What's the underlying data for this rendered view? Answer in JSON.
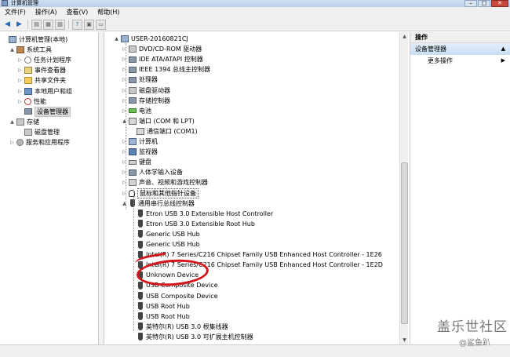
{
  "window": {
    "title": "计算机管理"
  },
  "menu": [
    "文件(F)",
    "操作(A)",
    "查看(V)",
    "帮助(H)"
  ],
  "left_tree": [
    {
      "label": "计算机管理(本地)",
      "icon": "computer-icon",
      "level": 0,
      "exp": ""
    },
    {
      "label": "系统工具",
      "icon": "tools-icon",
      "level": 1,
      "exp": "▲"
    },
    {
      "label": "任务计划程序",
      "icon": "clock-icon",
      "level": 2,
      "exp": "▷"
    },
    {
      "label": "事件查看器",
      "icon": "event-log-icon",
      "level": 2,
      "exp": "▷"
    },
    {
      "label": "共享文件夹",
      "icon": "folder-icon",
      "level": 2,
      "exp": "▷"
    },
    {
      "label": "本地用户和组",
      "icon": "users-icon",
      "level": 2,
      "exp": "▷"
    },
    {
      "label": "性能",
      "icon": "performance-icon",
      "level": 2,
      "exp": "▷"
    },
    {
      "label": "设备管理器",
      "icon": "device-manager-icon",
      "level": 2,
      "exp": "",
      "selected": true
    },
    {
      "label": "存储",
      "icon": "storage-icon",
      "level": 1,
      "exp": "▲"
    },
    {
      "label": "磁盘管理",
      "icon": "disk-icon",
      "level": 2,
      "exp": ""
    },
    {
      "label": "服务和应用程序",
      "icon": "services-icon",
      "level": 1,
      "exp": "▷"
    }
  ],
  "device_tree": [
    {
      "label": "USER-20160821CJ",
      "icon": "computer-icon",
      "level": 0,
      "exp": "▲"
    },
    {
      "label": "DVD/CD-ROM 驱动器",
      "icon": "dvd-drive-icon",
      "level": 1,
      "exp": "▷"
    },
    {
      "label": "IDE ATA/ATAPI 控制器",
      "icon": "ide-controller-icon",
      "level": 1,
      "exp": "▷"
    },
    {
      "label": "IEEE 1394 总线主控制器",
      "icon": "firewire-icon",
      "level": 1,
      "exp": "▷"
    },
    {
      "label": "处理器",
      "icon": "processor-icon",
      "level": 1,
      "exp": "▷"
    },
    {
      "label": "磁盘驱动器",
      "icon": "disk-drive-icon",
      "level": 1,
      "exp": "▷"
    },
    {
      "label": "存储控制器",
      "icon": "storage-controller-icon",
      "level": 1,
      "exp": "▷"
    },
    {
      "label": "电池",
      "icon": "battery-icon",
      "level": 1,
      "exp": "▷"
    },
    {
      "label": "端口 (COM 和 LPT)",
      "icon": "port-icon",
      "level": 1,
      "exp": "▲"
    },
    {
      "label": "通信端口 (COM1)",
      "icon": "port-icon",
      "level": 2,
      "exp": ""
    },
    {
      "label": "计算机",
      "icon": "computer-icon",
      "level": 1,
      "exp": "▷"
    },
    {
      "label": "监视器",
      "icon": "monitor-icon",
      "level": 1,
      "exp": "▷"
    },
    {
      "label": "键盘",
      "icon": "keyboard-icon",
      "level": 1,
      "exp": "▷"
    },
    {
      "label": "人体学输入设备",
      "icon": "hid-icon",
      "level": 1,
      "exp": "▷"
    },
    {
      "label": "声音、视频和游戏控制器",
      "icon": "sound-icon",
      "level": 1,
      "exp": "▷"
    },
    {
      "label": "鼠标和其他指针设备",
      "icon": "mouse-icon",
      "level": 1,
      "exp": "▷",
      "selected": true
    },
    {
      "label": "通用串行总线控制器",
      "icon": "usb-icon",
      "level": 1,
      "exp": "▲"
    },
    {
      "label": "Etron USB 3.0 Extensible Host Controller",
      "icon": "usb-icon",
      "level": 2,
      "exp": ""
    },
    {
      "label": "Etron USB 3.0 Extensible Root Hub",
      "icon": "usb-icon",
      "level": 2,
      "exp": ""
    },
    {
      "label": "Generic USB Hub",
      "icon": "usb-icon",
      "level": 2,
      "exp": ""
    },
    {
      "label": "Generic USB Hub",
      "icon": "usb-icon",
      "level": 2,
      "exp": ""
    },
    {
      "label": "Intel(R) 7 Series/C216 Chipset Family USB Enhanced Host Controller - 1E26",
      "icon": "usb-icon",
      "level": 2,
      "exp": ""
    },
    {
      "label": "Intel(R) 7 Series/C216 Chipset Family USB Enhanced Host Controller - 1E2D",
      "icon": "usb-icon",
      "level": 2,
      "exp": ""
    },
    {
      "label": "Unknown Device",
      "icon": "usb-icon",
      "level": 2,
      "exp": ""
    },
    {
      "label": "USB Composite Device",
      "icon": "usb-icon",
      "level": 2,
      "exp": ""
    },
    {
      "label": "USB Composite Device",
      "icon": "usb-icon",
      "level": 2,
      "exp": ""
    },
    {
      "label": "USB Root Hub",
      "icon": "usb-icon",
      "level": 2,
      "exp": ""
    },
    {
      "label": "USB Root Hub",
      "icon": "usb-icon",
      "level": 2,
      "exp": ""
    },
    {
      "label": "英特尔(R) USB 3.0 根集线器",
      "icon": "usb-icon",
      "level": 2,
      "exp": ""
    },
    {
      "label": "英特尔(R) USB 3.0 可扩展主机控制器",
      "icon": "usb-icon",
      "level": 2,
      "exp": ""
    }
  ],
  "actions": {
    "header": "操作",
    "selected": "设备管理器",
    "more": "更多操作"
  },
  "watermark": {
    "line1": "盖乐世社区",
    "line2": "@鲨鱼趴"
  },
  "colors": {
    "annotation": "#d4141b",
    "selection": "#c9dff4"
  }
}
